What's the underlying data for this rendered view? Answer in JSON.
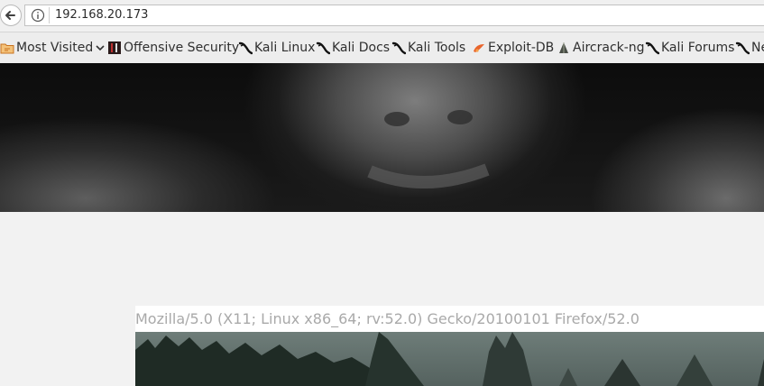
{
  "browser": {
    "url": "192.168.20.173"
  },
  "bookmarks": [
    {
      "label": "Most Visited",
      "icon": "folder-icon"
    },
    {
      "label": "Offensive Security",
      "icon": "offsec-icon"
    },
    {
      "label": "Kali Linux",
      "icon": "kali-dragon-icon"
    },
    {
      "label": "Kali Docs",
      "icon": "kali-dragon-icon"
    },
    {
      "label": "Kali Tools",
      "icon": "kali-dragon-icon"
    },
    {
      "label": "Exploit-DB",
      "icon": "exploit-db-icon"
    },
    {
      "label": "Aircrack-ng",
      "icon": "aircrack-icon"
    },
    {
      "label": "Kali Forums",
      "icon": "kali-dragon-icon"
    },
    {
      "label": "Ne",
      "icon": "kali-dragon-icon"
    }
  ],
  "page": {
    "user_agent": "Mozilla/5.0 (X11; Linux x86_64; rv:52.0) Gecko/20100101 Firefox/52.0"
  },
  "colors": {
    "page_background": "#f2f2f2",
    "user_agent_text": "#a9a9a9"
  }
}
